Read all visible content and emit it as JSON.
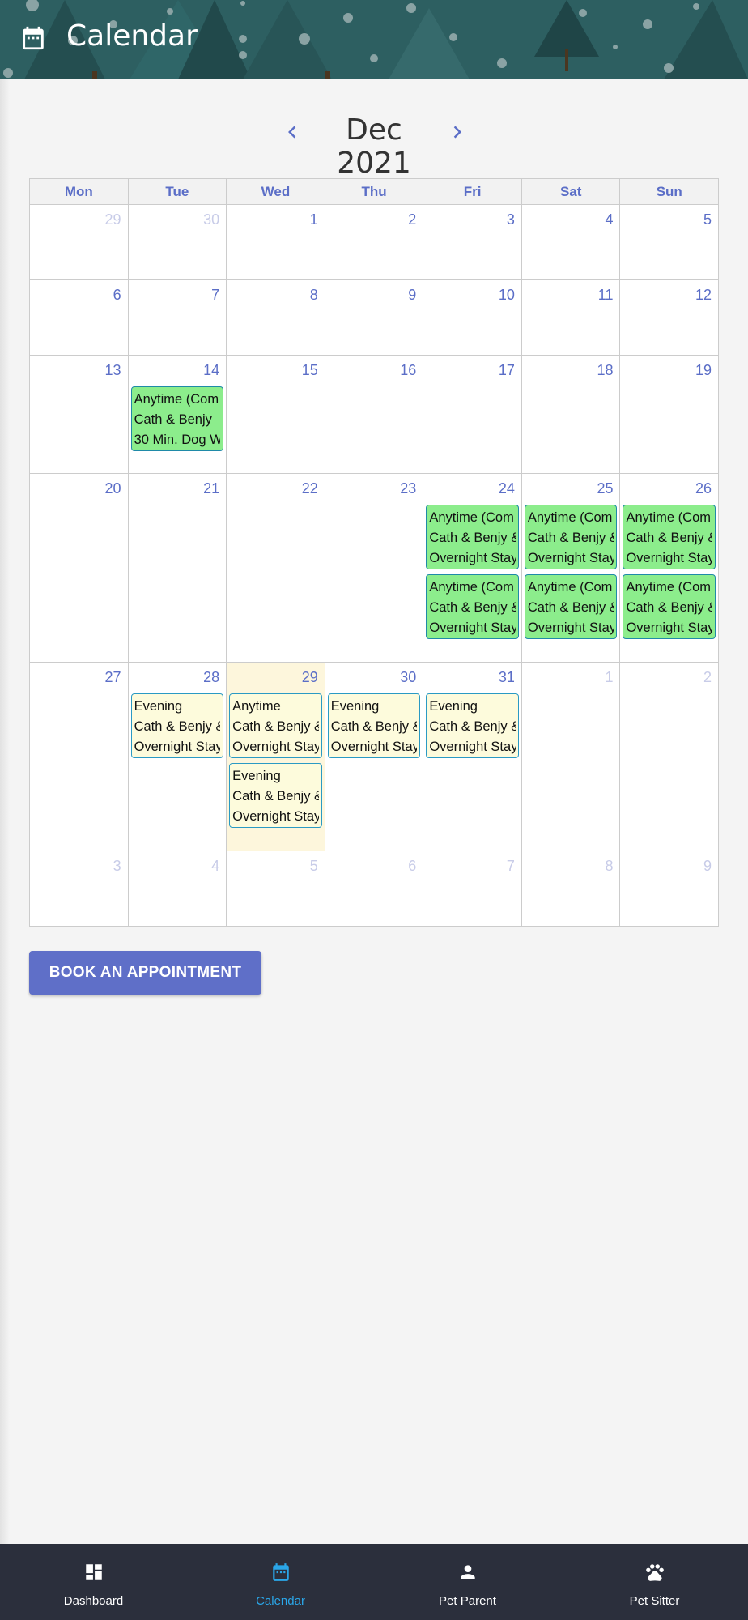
{
  "header": {
    "title": "Calendar",
    "icon": "calendar-icon"
  },
  "month_nav": {
    "label": "Dec 2021"
  },
  "weekdays": [
    "Mon",
    "Tue",
    "Wed",
    "Thu",
    "Fri",
    "Sat",
    "Sun"
  ],
  "weeks": [
    {
      "days": [
        {
          "num": "29",
          "other": true
        },
        {
          "num": "30",
          "other": true
        },
        {
          "num": "1"
        },
        {
          "num": "2"
        },
        {
          "num": "3"
        },
        {
          "num": "4"
        },
        {
          "num": "5"
        }
      ]
    },
    {
      "days": [
        {
          "num": "6"
        },
        {
          "num": "7"
        },
        {
          "num": "8"
        },
        {
          "num": "9"
        },
        {
          "num": "10"
        },
        {
          "num": "11"
        },
        {
          "num": "12"
        }
      ]
    },
    {
      "days": [
        {
          "num": "13"
        },
        {
          "num": "14",
          "events": [
            {
              "color": "green",
              "lines": [
                "Anytime (Com",
                "Cath & Benjy",
                "30 Min. Dog W"
              ]
            }
          ]
        },
        {
          "num": "15"
        },
        {
          "num": "16"
        },
        {
          "num": "17"
        },
        {
          "num": "18"
        },
        {
          "num": "19"
        }
      ]
    },
    {
      "days": [
        {
          "num": "20"
        },
        {
          "num": "21"
        },
        {
          "num": "22"
        },
        {
          "num": "23"
        },
        {
          "num": "24",
          "events": [
            {
              "color": "green",
              "lines": [
                "Anytime (Com",
                "Cath & Benjy &",
                "Overnight Stay"
              ]
            },
            {
              "color": "green",
              "lines": [
                "Anytime (Com",
                "Cath & Benjy &",
                "Overnight Stay"
              ]
            }
          ]
        },
        {
          "num": "25",
          "events": [
            {
              "color": "green",
              "lines": [
                "Anytime (Com",
                "Cath & Benjy &",
                "Overnight Stay"
              ]
            },
            {
              "color": "green",
              "lines": [
                "Anytime (Com",
                "Cath & Benjy &",
                "Overnight Stay"
              ]
            }
          ]
        },
        {
          "num": "26",
          "events": [
            {
              "color": "green",
              "lines": [
                "Anytime (Com",
                "Cath & Benjy &",
                "Overnight Stay"
              ]
            },
            {
              "color": "green",
              "lines": [
                "Anytime (Com",
                "Cath & Benjy &",
                "Overnight Stay"
              ]
            }
          ]
        }
      ]
    },
    {
      "days": [
        {
          "num": "27"
        },
        {
          "num": "28",
          "events": [
            {
              "color": "yellow",
              "lines": [
                "Evening",
                "Cath & Benjy &",
                "Overnight Stay"
              ]
            }
          ]
        },
        {
          "num": "29",
          "today": true,
          "events": [
            {
              "color": "yellow",
              "lines": [
                "Anytime",
                "Cath & Benjy &",
                "Overnight Stay"
              ]
            },
            {
              "color": "yellow",
              "lines": [
                "Evening",
                "Cath & Benjy &",
                "Overnight Stay"
              ]
            }
          ]
        },
        {
          "num": "30",
          "events": [
            {
              "color": "yellow",
              "lines": [
                "Evening",
                "Cath & Benjy &",
                "Overnight Stay"
              ]
            }
          ]
        },
        {
          "num": "31",
          "events": [
            {
              "color": "yellow",
              "lines": [
                "Evening",
                "Cath & Benjy &",
                "Overnight Stay"
              ]
            }
          ]
        },
        {
          "num": "1",
          "other": true
        },
        {
          "num": "2",
          "other": true
        }
      ]
    },
    {
      "days": [
        {
          "num": "3",
          "other": true
        },
        {
          "num": "4",
          "other": true
        },
        {
          "num": "5",
          "other": true
        },
        {
          "num": "6",
          "other": true
        },
        {
          "num": "7",
          "other": true
        },
        {
          "num": "8",
          "other": true
        },
        {
          "num": "9",
          "other": true
        }
      ]
    }
  ],
  "book_button": {
    "label": "BOOK AN APPOINTMENT"
  },
  "bottom_nav": [
    {
      "label": "Dashboard",
      "icon": "dashboard-icon",
      "active": false
    },
    {
      "label": "Calendar",
      "icon": "calendar-icon",
      "active": true
    },
    {
      "label": "Pet Parent",
      "icon": "person-icon",
      "active": false
    },
    {
      "label": "Pet Sitter",
      "icon": "paw-icon",
      "active": false
    }
  ],
  "colors": {
    "accent": "#5f6fc8",
    "nav_active": "#2aa6e8",
    "event_green": "#8ced8c",
    "event_yellow": "#fdfbdc",
    "today_bg": "#fdf6dc",
    "header_bg": "#2b5c5e",
    "bottom_nav_bg": "#2b2f3c"
  }
}
